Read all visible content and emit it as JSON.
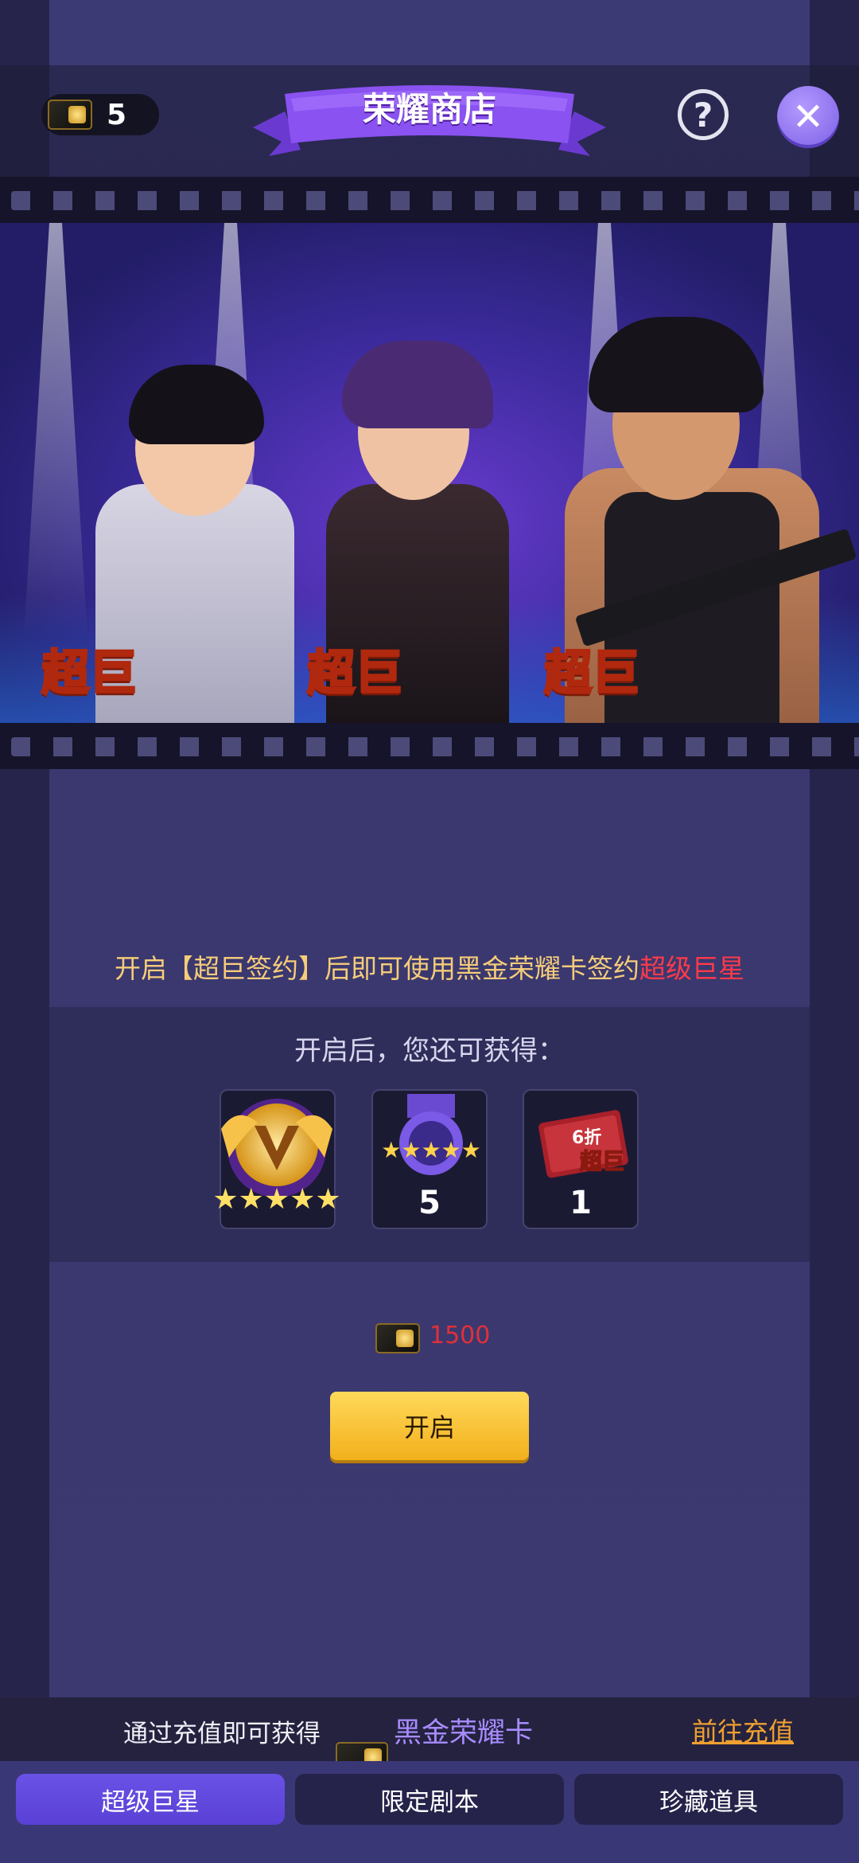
{
  "header": {
    "currency_value": "5",
    "title": "荣耀商店",
    "help_icon": "?",
    "close_icon": "✕"
  },
  "banner": {
    "characters": [
      {
        "badge": "超巨"
      },
      {
        "badge": "超巨"
      },
      {
        "badge": "超巨"
      }
    ]
  },
  "info": {
    "prefix": "开启",
    "bracket_text": "【超巨签约】",
    "middle": "后即可使用黑金荣耀卡签约",
    "highlight": "超级巨星"
  },
  "rewards": {
    "heading": "开启后，您还可获得：",
    "items": [
      {
        "icon": "v-emblem-five-star-icon",
        "count": ""
      },
      {
        "icon": "five-star-medal-icon",
        "count": "5"
      },
      {
        "icon": "discount-ticket-icon",
        "count": "1",
        "ticket_discount": "6折",
        "ticket_label": "超巨"
      }
    ]
  },
  "purchase": {
    "price": "1500",
    "button_label": "开启"
  },
  "recharge": {
    "text": "通过充值即可获得",
    "card_name": "黑金荣耀卡",
    "link": "前往充值"
  },
  "tabs": [
    {
      "label": "超级巨星",
      "active": true
    },
    {
      "label": "限定剧本",
      "active": false
    },
    {
      "label": "珍藏道具",
      "active": false
    }
  ],
  "colors": {
    "accent_purple": "#7a5ee6",
    "button_yellow": "#f2b01c",
    "price_red": "#e0303a",
    "highlight_red": "#ff3a4a",
    "info_gold": "#f6cc7a"
  }
}
